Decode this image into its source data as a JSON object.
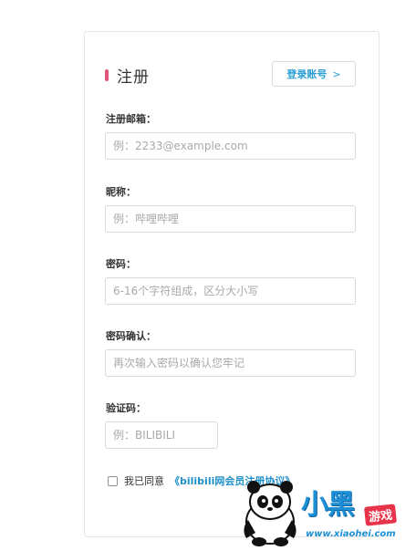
{
  "header": {
    "title": "注册",
    "login_button": "登录账号",
    "login_chevron": ">"
  },
  "fields": [
    {
      "label": "注册邮箱：",
      "placeholder": "例：2233@example.com"
    },
    {
      "label": "昵称：",
      "placeholder": "例：哔哩哔哩"
    },
    {
      "label": "密码：",
      "placeholder": "6-16个字符组成，区分大小写"
    },
    {
      "label": "密码确认：",
      "placeholder": "再次输入密码以确认您牢记"
    },
    {
      "label": "验证码：",
      "placeholder": "例：BILIBILI"
    }
  ],
  "agreement": {
    "prefix": "我已同意",
    "link": "《bilibili网会员注册协议》",
    "checked": false
  },
  "watermark": {
    "logo_text": "小黑",
    "badge": "游戏",
    "url": "www.xiaohei.com"
  },
  "colors": {
    "accent": "#e0567a",
    "link": "#1f90c8",
    "border": "#d6dbe1"
  }
}
